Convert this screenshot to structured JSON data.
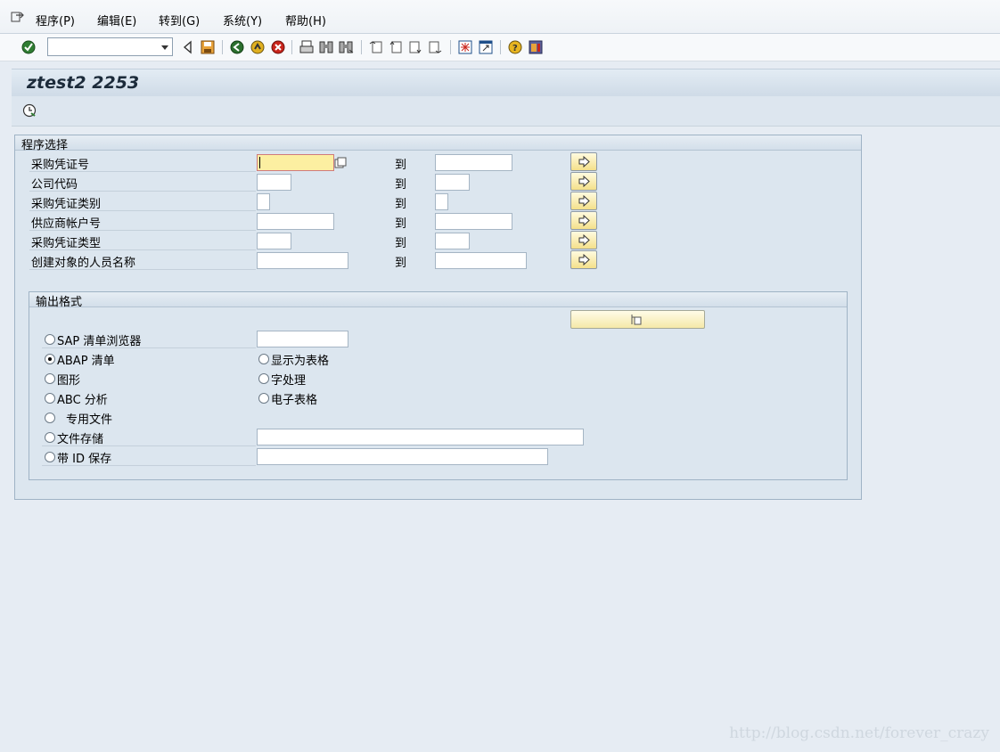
{
  "menu": {
    "items": [
      "程序(P)",
      "编辑(E)",
      "转到(G)",
      "系统(Y)",
      "帮助(H)"
    ]
  },
  "toolbar": {
    "command_field_value": "",
    "icons": [
      "enter-icon",
      "back-icon",
      "save-icon",
      "back-green-icon",
      "exit-icon",
      "cancel-icon",
      "print-icon",
      "find-icon",
      "find-next-icon",
      "first-page-icon",
      "previous-page-icon",
      "next-page-icon",
      "last-page-icon",
      "create-session-icon",
      "shortcut-icon",
      "help-icon",
      "layout-menu-icon"
    ]
  },
  "title": "ztest2 2253",
  "selection": {
    "title": "程序选择",
    "to_label": "到",
    "rows": [
      {
        "label": "采购凭证号"
      },
      {
        "label": "公司代码"
      },
      {
        "label": "采购凭证类别"
      },
      {
        "label": "供应商帐户号"
      },
      {
        "label": "采购凭证类型"
      },
      {
        "label": "创建对象的人员名称"
      }
    ]
  },
  "output": {
    "title": "输出格式",
    "options": {
      "sap_list_viewer": "SAP 清单浏览器",
      "abap_list": "ABAP 清单",
      "graphic": "图形",
      "abc_analysis": "ABC 分析",
      "private_file": "专用文件",
      "file_store": "文件存储",
      "save_with_id": "带 ID 保存",
      "display_as_table": "显示为表格",
      "word_processing": "字处理",
      "spreadsheet": "电子表格"
    },
    "selected": "abap_list"
  },
  "watermark": "http://blog.csdn.net/forever_crazy",
  "colors": {
    "background": "#e6ecf3",
    "group_background": "#dce6ef",
    "focused_field": "#fcefa1",
    "button_yellow": "#f4e08a"
  }
}
